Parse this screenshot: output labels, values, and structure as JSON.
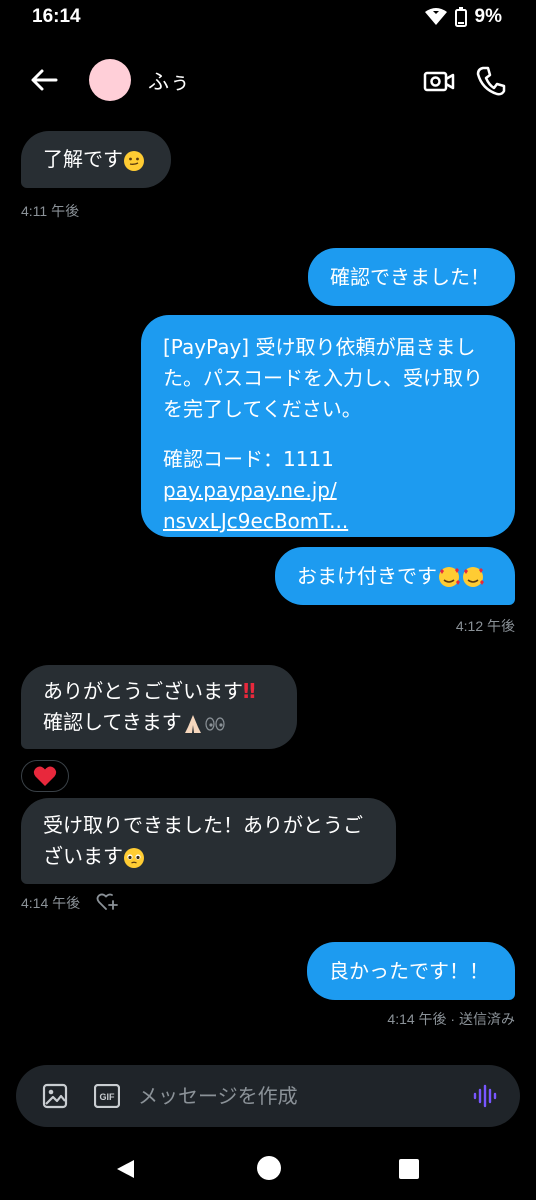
{
  "status": {
    "time": "16:14",
    "battery": "9%"
  },
  "header": {
    "contact_name": "ふぅ"
  },
  "messages": {
    "m1": {
      "text": "了解です"
    },
    "m1_time": "4:11 午後",
    "m2": {
      "text": "確認できました！"
    },
    "m3": {
      "line1": "[PayPay] 受け取り依頼が届きまし",
      "line2": "た。パスコードを入力し、受け取り",
      "line3": "を完了してください。",
      "line4": "確認コード：1111",
      "link1": "pay.paypay.ne.jp/",
      "link2": "nsvxLJc9ecBomT..."
    },
    "m4": {
      "text": "おまけ付きです"
    },
    "m4_time": "4:12 午後",
    "m5": {
      "line1": "ありがとうございます",
      "line2": "確認してきます"
    },
    "m6": {
      "line1": "受け取りできました！ありがとうご",
      "line2": "ざいます"
    },
    "m6_time": "4:14 午後",
    "m7": {
      "text": "良かったです！！"
    },
    "m7_status": "4:14 午後 · 送信済み"
  },
  "composer": {
    "placeholder": "メッセージを作成"
  },
  "icons": {
    "back": "arrow-left-icon",
    "video": "video-camera-icon",
    "phone": "phone-icon",
    "image": "image-icon",
    "gif": "gif-icon",
    "voice": "voice-wave-icon",
    "reaction": "heart-icon"
  },
  "colors": {
    "outgoing": "#1d9bf0",
    "incoming": "#282e33",
    "accent_voice": "#7856ff"
  }
}
